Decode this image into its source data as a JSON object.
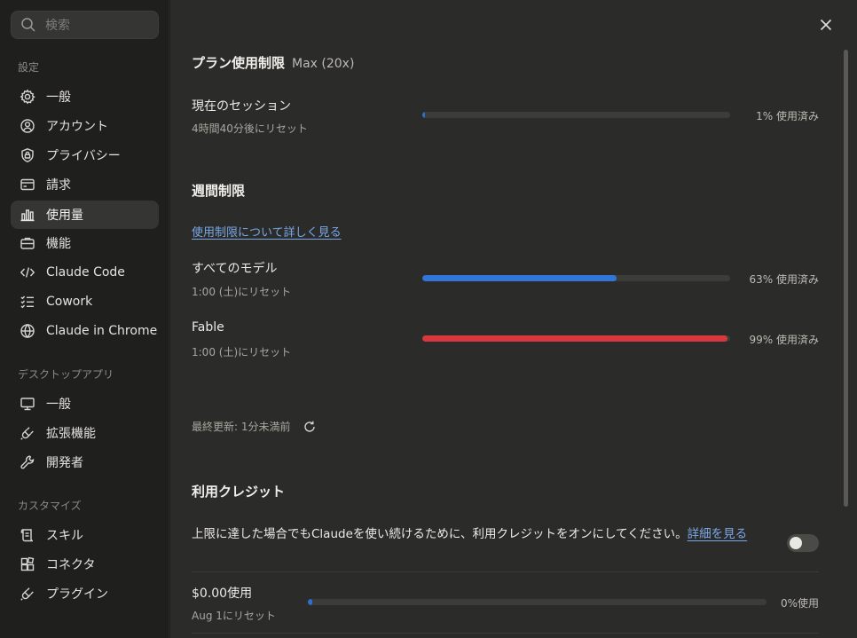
{
  "search": {
    "placeholder": "検索"
  },
  "sidebar": {
    "sections": [
      {
        "label": "設定",
        "items": [
          {
            "label": "一般",
            "icon": "gear-icon"
          },
          {
            "label": "アカウント",
            "icon": "user-circle-icon"
          },
          {
            "label": "プライバシー",
            "icon": "shield-lock-icon"
          },
          {
            "label": "請求",
            "icon": "credit-card-icon"
          },
          {
            "label": "使用量",
            "icon": "bar-chart-icon",
            "active": true
          },
          {
            "label": "機能",
            "icon": "briefcase-icon"
          },
          {
            "label": "Claude Code",
            "icon": "code-icon"
          },
          {
            "label": "Cowork",
            "icon": "checklist-icon"
          },
          {
            "label": "Claude in Chrome",
            "icon": "globe-icon"
          }
        ]
      },
      {
        "label": "デスクトップアプリ",
        "items": [
          {
            "label": "一般",
            "icon": "monitor-icon"
          },
          {
            "label": "拡張機能",
            "icon": "plug-icon"
          },
          {
            "label": "開発者",
            "icon": "wrench-icon"
          }
        ]
      },
      {
        "label": "カスタマイズ",
        "items": [
          {
            "label": "スキル",
            "icon": "scroll-icon"
          },
          {
            "label": "コネクタ",
            "icon": "blocks-icon"
          },
          {
            "label": "プラグイン",
            "icon": "plugin-icon"
          }
        ]
      }
    ]
  },
  "plan": {
    "title": "プラン使用制限",
    "tier": "Max (20x)",
    "session": {
      "title": "現在のセッション",
      "reset": "4時間40分後にリセット",
      "percent": 1,
      "percent_label": "1% 使用済み",
      "color": "#2f6fd0"
    }
  },
  "weekly": {
    "title": "週間制限",
    "learn_more": "使用制限について詳しく見る",
    "all_models": {
      "title": "すべてのモデル",
      "reset": "1:00 (土)にリセット",
      "percent": 63,
      "percent_label": "63% 使用済み",
      "color": "#2f76d8"
    },
    "fable": {
      "title": "Fable",
      "reset": "1:00 (土)にリセット",
      "percent": 99,
      "percent_label": "99% 使用済み",
      "color": "#d8383c"
    },
    "last_updated": "最終更新: 1分未満前"
  },
  "credits": {
    "title": "利用クレジット",
    "description": "上限に達した場合でもClaudeを使い続けるために、利用クレジットをオンにしてください。",
    "details_link": "詳細を見る",
    "toggle_on": false,
    "usage": {
      "title": "$0.00使用",
      "reset": "Aug 1にリセット",
      "percent": 0,
      "percent_label": "0%使用",
      "color": "#2f6fd0"
    }
  }
}
